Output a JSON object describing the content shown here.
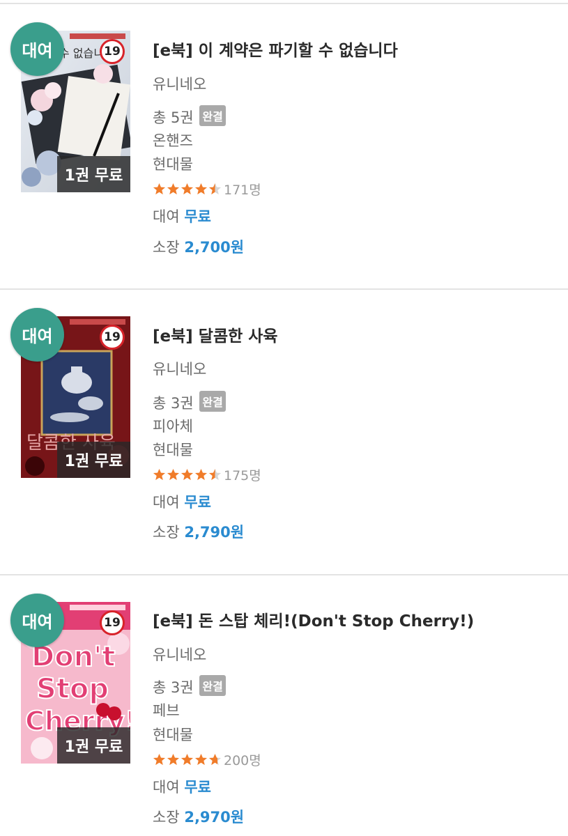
{
  "colors": {
    "rent_badge": "#3a9e8c",
    "price_blue": "#2a8bd0",
    "star_orange": "#f07c2a",
    "age_red": "#d8232a"
  },
  "items": [
    {
      "rent_badge": "대여",
      "age_badge": "19",
      "free_badge": "1권 무료",
      "title": "[e북] 이 계약은 파기할 수 없습니다",
      "author": "유니네오",
      "volumes_label": "총 5권",
      "complete_label": "완결",
      "publisher": "온핸즈",
      "genre": "현대물",
      "rating": 4.5,
      "rating_count": "171명",
      "rent_label": "대여",
      "rent_price": "무료",
      "own_label": "소장",
      "own_price": "2,700원"
    },
    {
      "rent_badge": "대여",
      "age_badge": "19",
      "free_badge": "1권 무료",
      "title": "[e북] 달콤한 사육",
      "author": "유니네오",
      "volumes_label": "총 3권",
      "complete_label": "완결",
      "publisher": "피아체",
      "genre": "현대물",
      "rating": 4.5,
      "rating_count": "175명",
      "rent_label": "대여",
      "rent_price": "무료",
      "own_label": "소장",
      "own_price": "2,790원"
    },
    {
      "rent_badge": "대여",
      "age_badge": "19",
      "free_badge": "1권 무료",
      "title": "[e북] 돈 스탑 체리!(Don't Stop Cherry!)",
      "author": "유니네오",
      "volumes_label": "총 3권",
      "complete_label": "완결",
      "publisher": "페브",
      "genre": "현대물",
      "rating": 4.7,
      "rating_count": "200명",
      "rent_label": "대여",
      "rent_price": "무료",
      "own_label": "소장",
      "own_price": "2,970원"
    }
  ]
}
